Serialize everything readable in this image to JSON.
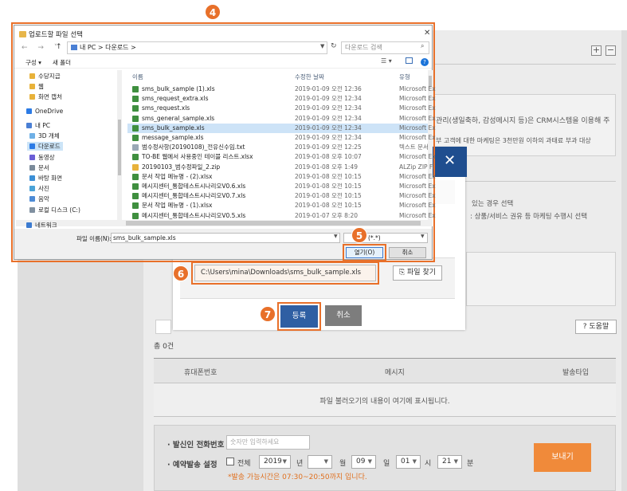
{
  "step_badges": [
    "4",
    "5",
    "6",
    "7"
  ],
  "background_page": {
    "plus_label": "+",
    "minus_label": "−",
    "desc_line1": "관리(생일축하, 감성메시지 등)은 CRM시스템을 이용해 주",
    "desc_line2": "부 고객에 대한 마케팅은 3천만원 이하의 과태료 부과 대상",
    "cond_line1": "있는 경우 선택",
    "cond_line2": ": 상품/서비스 권유 등 마케팅 수행시 선택",
    "help_label": "? 도움말",
    "total_count": "총 0건",
    "table": {
      "headers": [
        "휴대폰번호",
        "메시지",
        "발송타입"
      ],
      "empty_message": "파일 불러오기의 내용이 여기에 표시됩니다."
    },
    "send": {
      "caller_label": "· 발신인 전화번호",
      "caller_placeholder": "숫자만 입력하세요",
      "schedule_label": "· 예약발송 설정",
      "all_label": "전체",
      "year": "2019",
      "year_unit": "년",
      "month": "",
      "month_unit": "월",
      "day": "09",
      "day_unit": "일",
      "hour": "01",
      "hour_unit": "시",
      "minute": "21",
      "minute_unit": "분",
      "note": "*발송 가능시간은 07:30~20:50까지 입니다.",
      "send_button": "보내기"
    }
  },
  "modal": {
    "close_label": "✕",
    "path_value": "C:\\Users\\mina\\Downloads\\sms_bulk_sample.xls",
    "find_button": "파일 찾기",
    "register_button": "등록",
    "cancel_button": "취소"
  },
  "file_dialog": {
    "title": "업로드할 파일 선택",
    "close_label": "✕",
    "address": "내 PC  >  다운로드  >",
    "search_placeholder": "다운로드 검색",
    "toolbar": {
      "organize": "구성 ▾",
      "new_folder": "새 폴더"
    },
    "nav_items": [
      {
        "label": "수당지급",
        "icon": "folder"
      },
      {
        "label": "웹",
        "icon": "folder"
      },
      {
        "label": "화면 캡처",
        "icon": "folder"
      },
      {
        "label": "OneDrive",
        "icon": "cloud"
      },
      {
        "label": "내 PC",
        "icon": "pc"
      },
      {
        "label": "3D 개체",
        "icon": "3d"
      },
      {
        "label": "다운로드",
        "icon": "download"
      },
      {
        "label": "동영상",
        "icon": "video"
      },
      {
        "label": "문서",
        "icon": "document"
      },
      {
        "label": "바탕 화면",
        "icon": "desktop"
      },
      {
        "label": "사진",
        "icon": "picture"
      },
      {
        "label": "음악",
        "icon": "music"
      },
      {
        "label": "로컬 디스크 (C:)",
        "icon": "disk"
      },
      {
        "label": "네트워크",
        "icon": "network"
      }
    ],
    "columns": [
      "이름",
      "수정한 날짜",
      "유형"
    ],
    "files": [
      {
        "name": "sms_bulk_sample (1).xls",
        "date": "2019-01-09 오전 12:36",
        "type": "Microsoft Ex",
        "icon": "xls"
      },
      {
        "name": "sms_request_extra.xls",
        "date": "2019-01-09 오전 12:34",
        "type": "Microsoft Ex",
        "icon": "xls"
      },
      {
        "name": "sms_request.xls",
        "date": "2019-01-09 오전 12:34",
        "type": "Microsoft Ex",
        "icon": "xls"
      },
      {
        "name": "sms_general_sample.xls",
        "date": "2019-01-09 오전 12:34",
        "type": "Microsoft Ex",
        "icon": "xls"
      },
      {
        "name": "sms_bulk_sample.xls",
        "date": "2019-01-09 오전 12:34",
        "type": "Microsoft Ex",
        "icon": "xls",
        "selected": true
      },
      {
        "name": "message_sample.xls",
        "date": "2019-01-09 오전 12:34",
        "type": "Microsoft Ex",
        "icon": "xls"
      },
      {
        "name": "범수정사항(20190108)_전유신수임.txt",
        "date": "2019-01-09 오전 12:25",
        "type": "텍스트 문서",
        "icon": "txt"
      },
      {
        "name": "TO-BE 웹에서 사용중인 테이블 리스트.xlsx",
        "date": "2019-01-08 오후 10:07",
        "type": "Microsoft Ex",
        "icon": "xls"
      },
      {
        "name": "20190103_범수정파일_2.zip",
        "date": "2019-01-08 오후 1:49",
        "type": "ALZip ZIP Fi",
        "icon": "zip"
      },
      {
        "name": "문서 작업 메뉴명 - (2).xlsx",
        "date": "2019-01-08 오전 10:15",
        "type": "Microsoft Ex",
        "icon": "xls"
      },
      {
        "name": "메시지센터_통합테스트시나리오V0.6.xls",
        "date": "2019-01-08 오전 10:15",
        "type": "Microsoft Ex",
        "icon": "xls"
      },
      {
        "name": "메시지센터_통합테스트시나리오V0.7.xls",
        "date": "2019-01-08 오전 10:15",
        "type": "Microsoft Ex",
        "icon": "xls"
      },
      {
        "name": "문서 작업 메뉴명 - (1).xlsx",
        "date": "2019-01-08 오전 10:15",
        "type": "Microsoft Ex",
        "icon": "xls"
      },
      {
        "name": "메시지센터_통합테스트시나리오V0.5.xls",
        "date": "2019-01-07 오후 8:20",
        "type": "Microsoft Ex",
        "icon": "xls"
      }
    ],
    "filename_label": "파일 이름(N):",
    "filename_value": "sms_bulk_sample.xls",
    "filetype_value": "(*.*)",
    "open_button": "열기(O)",
    "cancel_button": "취소"
  },
  "colors": {
    "highlight": "#e8702a",
    "modal_header": "#1f4e8f",
    "register": "#2f5fa3",
    "send_button": "#f08a3a"
  }
}
